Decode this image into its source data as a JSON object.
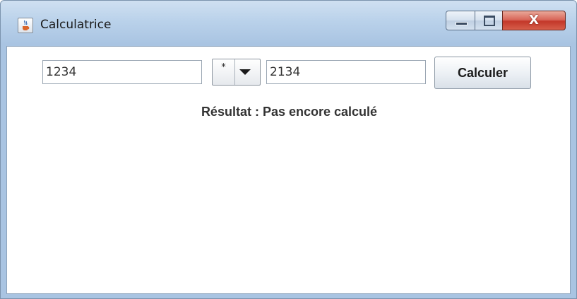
{
  "window": {
    "title": "Calculatrice",
    "icon": "java-cup-icon",
    "controls": {
      "minimize": "minimize-icon",
      "maximize": "maximize-icon",
      "close": "X"
    }
  },
  "form": {
    "operand_a": "1234",
    "operator": {
      "selected": "*"
    },
    "operand_b": "2134",
    "calculate_label": "Calculer"
  },
  "result": {
    "text": "Résultat : Pas encore calculé"
  },
  "colors": {
    "frame": "#b9d1ea",
    "close_button": "#c3382a",
    "text": "#333333"
  }
}
